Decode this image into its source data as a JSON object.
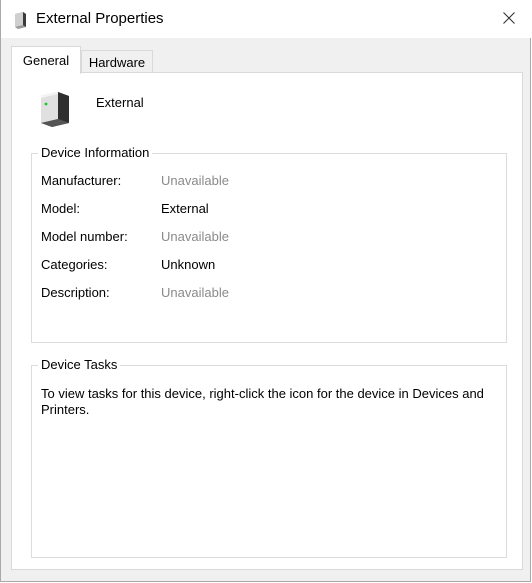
{
  "window": {
    "title": "External Properties",
    "icon": "drive-icon",
    "close": "close-icon"
  },
  "tabs": [
    {
      "label": "General",
      "active": true
    },
    {
      "label": "Hardware",
      "active": false
    }
  ],
  "device": {
    "name": "External",
    "icon": "external-drive-icon"
  },
  "device_information": {
    "legend": "Device Information",
    "rows": [
      {
        "label": "Manufacturer:",
        "value": "Unavailable"
      },
      {
        "label": "Model:",
        "value": "External"
      },
      {
        "label": "Model number:",
        "value": "Unavailable"
      },
      {
        "label": "Categories:",
        "value": "Unknown"
      },
      {
        "label": "Description:",
        "value": "Unavailable"
      }
    ]
  },
  "device_tasks": {
    "legend": "Device Tasks",
    "text": "To view tasks for this device, right-click the icon for the device in Devices and Printers."
  }
}
